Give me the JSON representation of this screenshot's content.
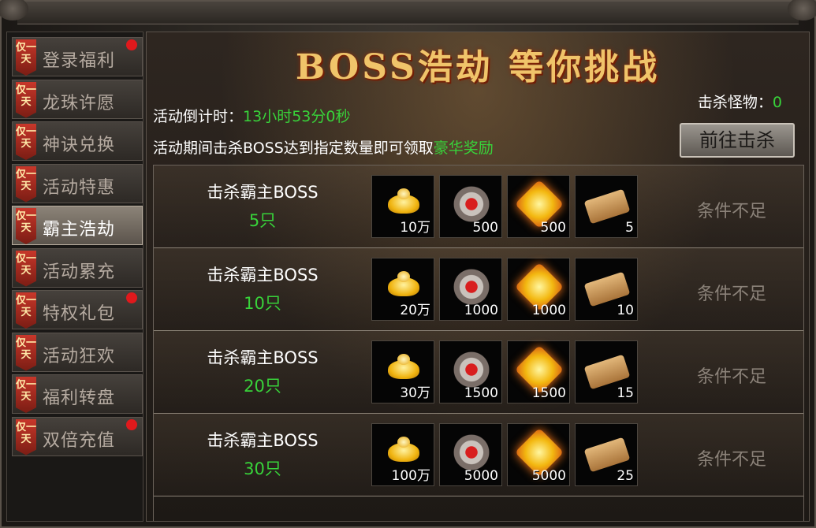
{
  "sidebar": {
    "items": [
      {
        "ribbon": "仅一天",
        "label": "登录福利",
        "dot": true,
        "active": false
      },
      {
        "ribbon": "仅一天",
        "label": "龙珠许愿",
        "dot": false,
        "active": false
      },
      {
        "ribbon": "仅一天",
        "label": "神诀兑换",
        "dot": false,
        "active": false
      },
      {
        "ribbon": "仅一天",
        "label": "活动特惠",
        "dot": false,
        "active": false
      },
      {
        "ribbon": "仅一天",
        "label": "霸主浩劫",
        "dot": false,
        "active": true
      },
      {
        "ribbon": "仅一天",
        "label": "活动累充",
        "dot": false,
        "active": false
      },
      {
        "ribbon": "仅一天",
        "label": "特权礼包",
        "dot": true,
        "active": false
      },
      {
        "ribbon": "仅一天",
        "label": "活动狂欢",
        "dot": false,
        "active": false
      },
      {
        "ribbon": "仅一天",
        "label": "福利转盘",
        "dot": false,
        "active": false
      },
      {
        "ribbon": "仅一天",
        "label": "双倍充值",
        "dot": true,
        "active": false
      }
    ]
  },
  "main": {
    "title": "BOSS浩劫 等你挑战",
    "countdown_label": "活动倒计时：",
    "countdown_value": "13小时53分0秒",
    "desc_prefix": "活动期间击杀BOSS达到指定数量即可领取",
    "desc_highlight": "豪华奖励",
    "kill_label": "击杀怪物：",
    "kill_value": "0",
    "go_button": "前往击杀",
    "rows": [
      {
        "label": "击杀霸主BOSS",
        "count": "5只",
        "rewards": [
          "10万",
          "500",
          "500",
          "5"
        ],
        "status": "条件不足"
      },
      {
        "label": "击杀霸主BOSS",
        "count": "10只",
        "rewards": [
          "20万",
          "1000",
          "1000",
          "10"
        ],
        "status": "条件不足"
      },
      {
        "label": "击杀霸主BOSS",
        "count": "20只",
        "rewards": [
          "30万",
          "1500",
          "1500",
          "15"
        ],
        "status": "条件不足"
      },
      {
        "label": "击杀霸主BOSS",
        "count": "30只",
        "rewards": [
          "100万",
          "5000",
          "5000",
          "25"
        ],
        "status": "条件不足"
      }
    ],
    "reward_icons": [
      "gold-ingot-icon",
      "medal-icon",
      "gem-icon",
      "scroll-icon"
    ]
  },
  "colors": {
    "highlight_green": "#38d33a",
    "dot_red": "#e0191c",
    "title_gold": "#f0c46a"
  }
}
